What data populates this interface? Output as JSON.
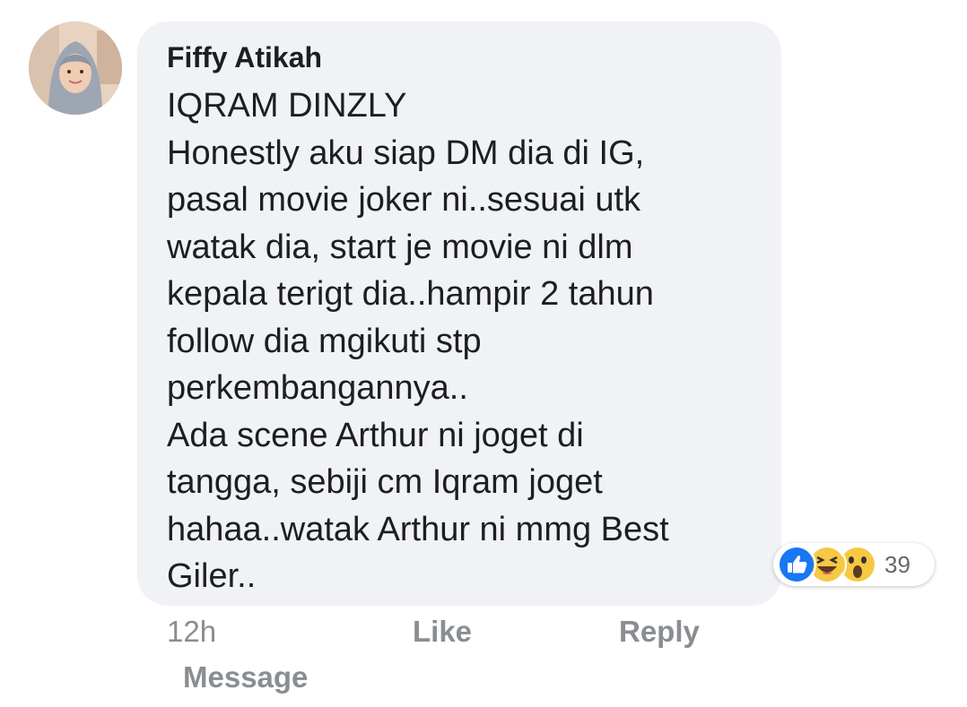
{
  "comment": {
    "author": "Fiffy Atikah",
    "lines": [
      "IQRAM DINZLY",
      "Honestly aku siap DM dia di IG,",
      "pasal movie joker ni..sesuai utk",
      "watak dia, start je movie ni dlm",
      "kepala terigt dia..hampir 2 tahun",
      "follow dia mgikuti stp",
      "perkembangannya..",
      "Ada scene Arthur ni joget di",
      "tangga, sebiji cm Iqram joget",
      "hahaa..watak Arthur ni mmg Best",
      "Giler.."
    ]
  },
  "reactions": {
    "icons": [
      "like-icon",
      "haha-icon",
      "wow-icon"
    ],
    "count": "39"
  },
  "actions": {
    "time": "12h",
    "like": "Like",
    "reply": "Reply",
    "message": "Message"
  },
  "colors": {
    "bubble": "#f0f2f5",
    "like_blue": "#1877f2",
    "emoji_yellow": "#f7c843",
    "meta_gray": "#8a8d91"
  }
}
